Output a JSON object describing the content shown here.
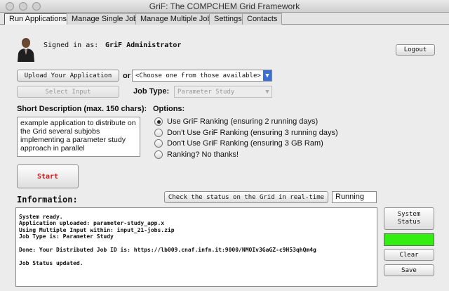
{
  "window": {
    "title": "GriF: The COMPCHEM Grid Framework"
  },
  "tabs": [
    {
      "label": "Run Applications",
      "active": true
    },
    {
      "label": "Manage Single Jobs",
      "active": false
    },
    {
      "label": "Manage Multiple Jobs",
      "active": false
    },
    {
      "label": "Settings",
      "active": false
    },
    {
      "label": "Contacts",
      "active": false
    }
  ],
  "user": {
    "signed_in_label": "Signed in as:",
    "name": "GriF Administrator",
    "logout_label": "Logout"
  },
  "upload": {
    "upload_button": "Upload Your Application",
    "or_label": "or",
    "app_select": "<Choose one from those available>",
    "select_input_button": "Select Input",
    "job_type_label": "Job Type:",
    "job_type_value": "Parameter Study"
  },
  "description": {
    "label": "Short Description (max. 150 chars):",
    "text": "example application to distribute on the Grid several subjobs implementing a parameter study approach in parallel"
  },
  "options": {
    "label": "Options:",
    "items": [
      {
        "label": "Use GriF Ranking (ensuring 2 running days)",
        "checked": true
      },
      {
        "label": "Don't Use GriF Ranking (ensuring 3 running days)",
        "checked": false
      },
      {
        "label": "Don't Use GriF Ranking (ensuring 3 GB Ram)",
        "checked": false
      },
      {
        "label": "Ranking? No thanks!",
        "checked": false
      }
    ]
  },
  "start": {
    "label": "Start",
    "color": "#d11a1a"
  },
  "information": {
    "label": "Information:",
    "check_status_button": "Check the status on the Grid in real-time",
    "status_value": "Running",
    "log_lines": [
      "System ready.",
      "Application uploaded: parameter-study_app.x",
      "Using Multiple Input within: input_21-jobs.zip",
      "Job Type is: Parameter Study",
      "",
      "Done: Your Distributed Job ID is: https://lb009.cnaf.infn.it:9000/NMOIv3GaGZ-c9H53qhQm4g",
      "",
      "Job Status updated."
    ]
  },
  "side_buttons": {
    "system_status": "System Status",
    "status_color": "#33ee11",
    "clear": "Clear",
    "save": "Save"
  }
}
